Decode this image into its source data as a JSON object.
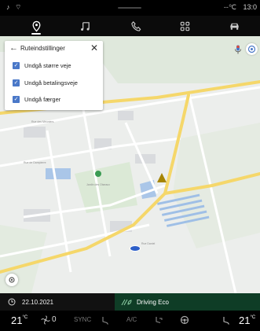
{
  "status_bar": {
    "left_icons": "♪ ⌔",
    "signal": "--℃",
    "time": "13:0"
  },
  "nav": {
    "items": [
      {
        "name": "location-pin",
        "active": true
      },
      {
        "name": "music-note",
        "active": false
      },
      {
        "name": "phone",
        "active": false
      },
      {
        "name": "apps-grid",
        "active": false
      },
      {
        "name": "car",
        "active": false
      }
    ]
  },
  "route_panel": {
    "title": "Ruteindstillinger",
    "options": [
      {
        "label": "Undgå større veje",
        "checked": true
      },
      {
        "label": "Undgå betalingsveje",
        "checked": true
      },
      {
        "label": "Undgå færger",
        "checked": true
      }
    ]
  },
  "info_bar": {
    "date": "22.10.2021",
    "mode": "Driving Eco"
  },
  "climate": {
    "left_temp": "21",
    "left_unit": "°C",
    "fan_value": "0",
    "sync_label": "SYNC",
    "ac_label": "A/C",
    "right_temp": "21",
    "right_unit": "°C"
  },
  "colors": {
    "accent_blue": "#4a78c8",
    "eco_green": "#0f3d26",
    "road_yellow": "#f5d76a"
  }
}
